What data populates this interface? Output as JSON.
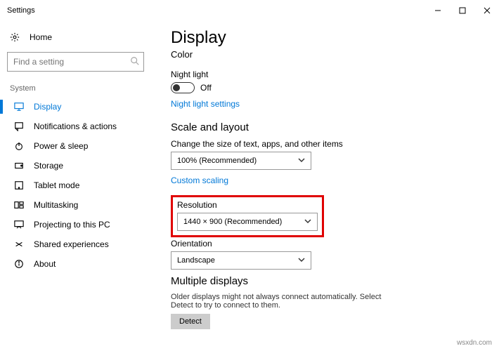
{
  "window": {
    "title": "Settings"
  },
  "sidebar": {
    "home": "Home",
    "search_placeholder": "Find a setting",
    "section": "System",
    "items": [
      {
        "label": "Display"
      },
      {
        "label": "Notifications & actions"
      },
      {
        "label": "Power & sleep"
      },
      {
        "label": "Storage"
      },
      {
        "label": "Tablet mode"
      },
      {
        "label": "Multitasking"
      },
      {
        "label": "Projecting to this PC"
      },
      {
        "label": "Shared experiences"
      },
      {
        "label": "About"
      }
    ]
  },
  "main": {
    "title": "Display",
    "color_header": "Color",
    "night_light_label": "Night light",
    "night_light_state": "Off",
    "night_light_link": "Night light settings",
    "scale_header": "Scale and layout",
    "scale_desc": "Change the size of text, apps, and other items",
    "scale_value": "100% (Recommended)",
    "custom_scaling": "Custom scaling",
    "resolution_label": "Resolution",
    "resolution_value": "1440 × 900 (Recommended)",
    "orientation_label": "Orientation",
    "orientation_value": "Landscape",
    "multi_header": "Multiple displays",
    "multi_desc": "Older displays might not always connect automatically. Select Detect to try to connect to them.",
    "detect": "Detect"
  },
  "watermark": "wsxdn.com"
}
